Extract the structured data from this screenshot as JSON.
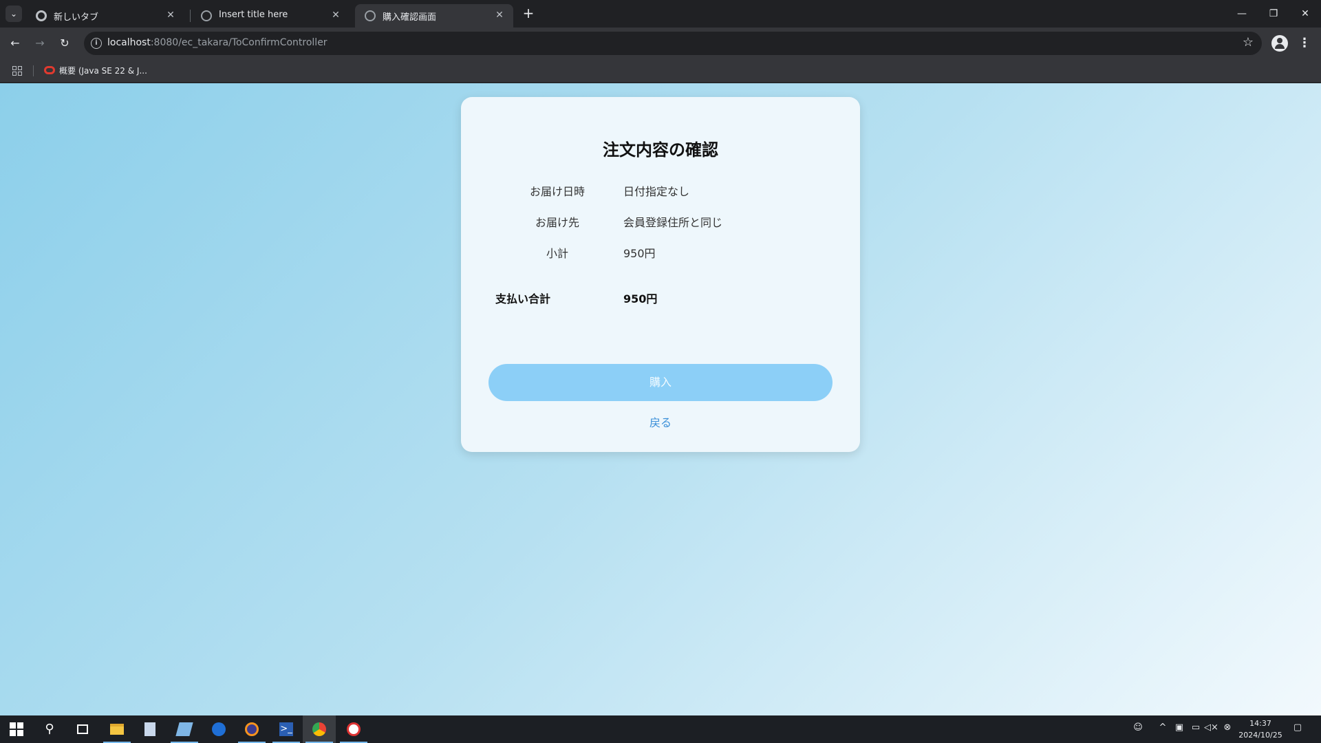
{
  "browser": {
    "tabs": [
      {
        "title": "新しいタブ",
        "icon": "chrome-icon",
        "active": false
      },
      {
        "title": "Insert title here",
        "icon": "globe-icon",
        "active": false
      },
      {
        "title": "購入確認画面",
        "icon": "globe-icon",
        "active": true
      }
    ],
    "close_glyph": "✕",
    "new_tab_glyph": "+",
    "url_host": "localhost",
    "url_rest": ":8080/ec_takara/ToConfirmController",
    "bookmarks": [
      {
        "label": "概要 (Java SE 22 & J...",
        "icon": "oracle-icon"
      }
    ]
  },
  "page": {
    "title": "注文内容の確認",
    "rows": [
      {
        "label": "お届け日時",
        "value": "日付指定なし"
      },
      {
        "label": "お届け先",
        "value": "会員登録住所と同じ"
      },
      {
        "label": "小計",
        "value": "950円"
      }
    ],
    "total": {
      "label": "支払い合計",
      "value": "950円"
    },
    "buy_button": "購入",
    "back_link": "戻る",
    "colors": {
      "accent": "#8ccff7",
      "link": "#3a8fd8"
    }
  },
  "taskbar": {
    "apps": [
      "windows-start-icon",
      "search-icon",
      "task-view-icon",
      "file-explorer-icon",
      "notepad-icon",
      "editor-icon",
      "thunderbird-icon",
      "eclipse-icon",
      "powershell-icon",
      "chrome-icon",
      "app-icon"
    ],
    "clock_time": "14:37",
    "clock_date": "2024/10/25"
  }
}
